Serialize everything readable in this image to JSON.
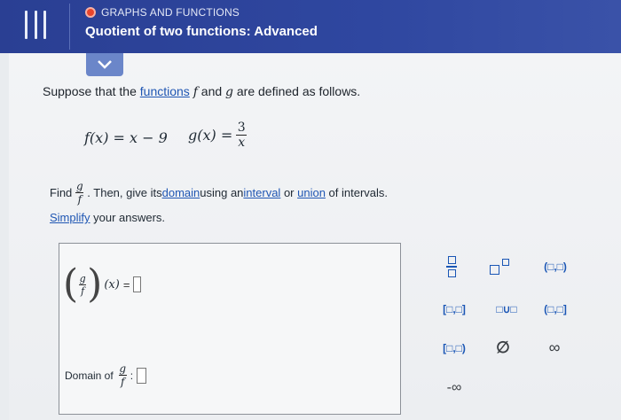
{
  "header": {
    "topic": "GRAPHS AND FUNCTIONS",
    "title": "Quotient of two functions: Advanced"
  },
  "question": {
    "intro_before": "Suppose that the ",
    "intro_link": "functions",
    "intro_after": " and ",
    "intro_end": " are defined as follows.",
    "f_name": "f",
    "g_name": "g",
    "f_def": "f(x) = x − 9",
    "g_prefix": "g(x) =",
    "g_num": "3",
    "g_den": "x",
    "find_label": "Find",
    "quot_num": "g",
    "quot_den": "f",
    "then_text": ". Then, give its ",
    "domain_link": "domain",
    "using_text": " using an ",
    "interval_link": "interval",
    "or_text": " or ",
    "union_link": "union",
    "of_text": " of intervals.",
    "simplify_link": "Simplify",
    "simplify_rest": " your answers."
  },
  "answer": {
    "lhs_x": "(x)",
    "eq": "=",
    "domain_label": "Domain of",
    "domain_colon": ":"
  },
  "palette": {
    "open_open": "(□,□)",
    "closed_closed": "[□,□]",
    "union": "□∪□",
    "open_closed": "(□,□]",
    "closed_open": "[□,□)",
    "empty": "∅",
    "infinity": "∞",
    "neg_infinity": "-∞"
  },
  "colors": {
    "header_bg": "#2f47a0",
    "link": "#1f56b3",
    "palette_accent": "#1a56b5",
    "topic_dot": "#e8452c"
  }
}
